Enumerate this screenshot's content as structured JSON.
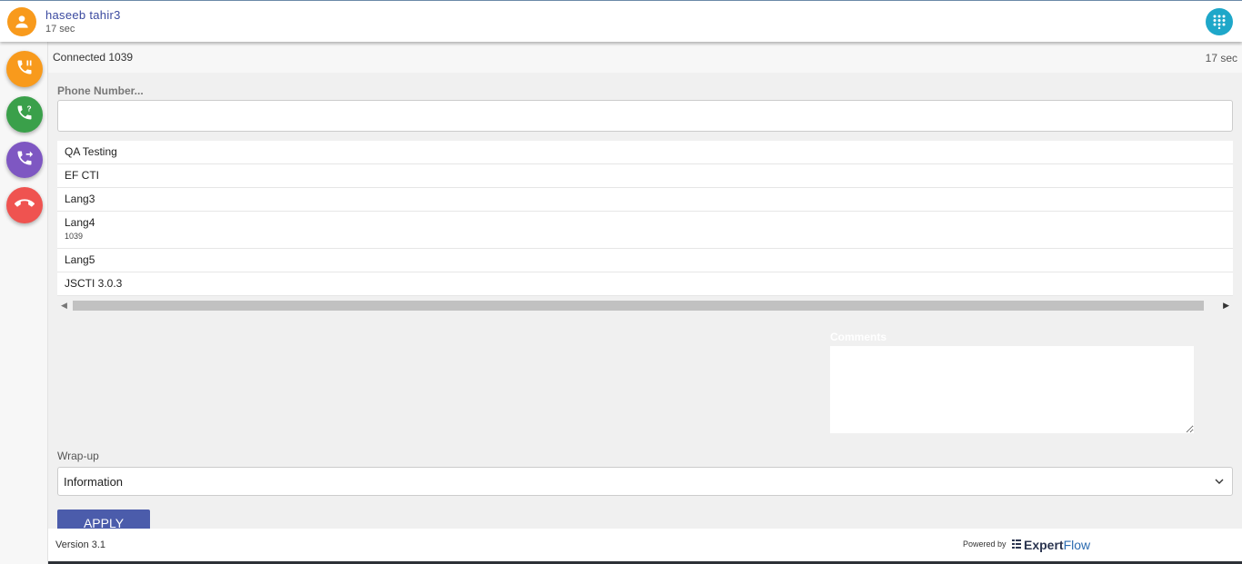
{
  "header": {
    "caller_name": "haseeb  tahir3",
    "call_duration": "17 sec",
    "icons": {
      "avatar": "person-icon",
      "dialpad": "dialpad-icon"
    },
    "colors": {
      "avatar": "#f89a1c",
      "dialpad": "#1ea7c9"
    }
  },
  "sidebar": {
    "buttons": [
      {
        "icon": "hold-call-icon",
        "color": "#f89a1c"
      },
      {
        "icon": "consult-call-icon",
        "color": "#3aa04a"
      },
      {
        "icon": "transfer-call-icon",
        "color": "#7e57c2"
      },
      {
        "icon": "end-call-icon",
        "color": "#ef5350"
      }
    ]
  },
  "status": {
    "connection": "Connected 1039",
    "timer": "17 sec"
  },
  "phone": {
    "label": "Phone Number...",
    "value": ""
  },
  "queues": [
    {
      "name": "QA Testing",
      "sub": ""
    },
    {
      "name": "EF CTI",
      "sub": ""
    },
    {
      "name": "Lang3",
      "sub": ""
    },
    {
      "name": "Lang4",
      "sub": "1039"
    },
    {
      "name": "Lang5",
      "sub": ""
    },
    {
      "name": "JSCTI 3.0.3",
      "sub": ""
    }
  ],
  "comments": {
    "label": "Comments",
    "value": ""
  },
  "wrapup": {
    "label": "Wrap-up",
    "selected": "Information"
  },
  "apply_label": "APPLY",
  "footer": {
    "version": "Version 3.1",
    "powered_by": "Powered by",
    "brand_part1": "Expert",
    "brand_part2": "Flow"
  },
  "accent_color": "#4b5cab"
}
